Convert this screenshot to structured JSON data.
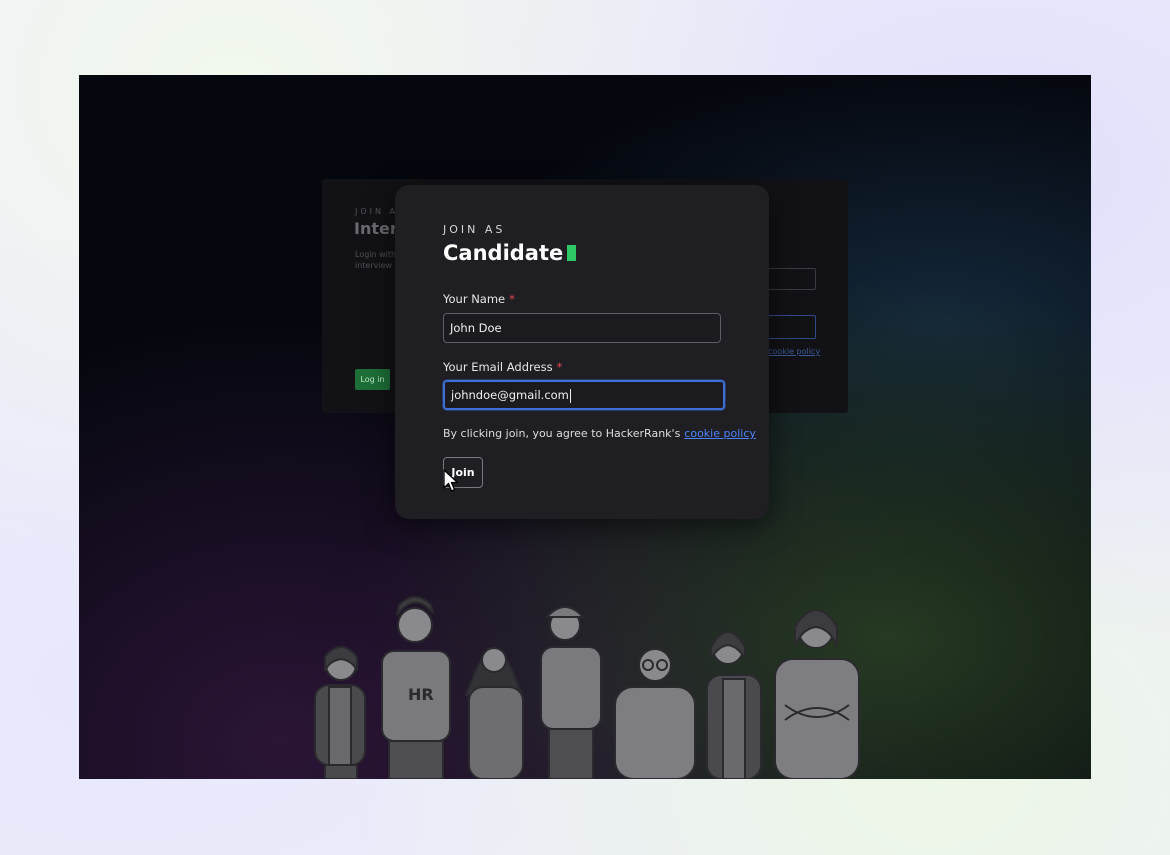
{
  "background_panel": {
    "eyebrow": "JOIN AS",
    "title": "Interv",
    "description": "Login with y interview",
    "policy_link": "cookie policy",
    "login_button": "Log in"
  },
  "illustration": {
    "shirt_text": "HR"
  },
  "modal": {
    "eyebrow": "JOIN AS",
    "title": "Candidate",
    "name_label": "Your Name",
    "name_value": "John Doe",
    "email_label": "Your Email Address",
    "email_value": "johndoe@gmail.com",
    "required_marker": "*",
    "consent_text": "By clicking join, you agree to HackerRank's",
    "cookie_link": "cookie policy",
    "join_button": "Join"
  },
  "colors": {
    "accent_green": "#2ec866",
    "link_blue": "#4c84ff",
    "focus_blue": "#3f6fd6",
    "required_red": "#e5484d"
  }
}
